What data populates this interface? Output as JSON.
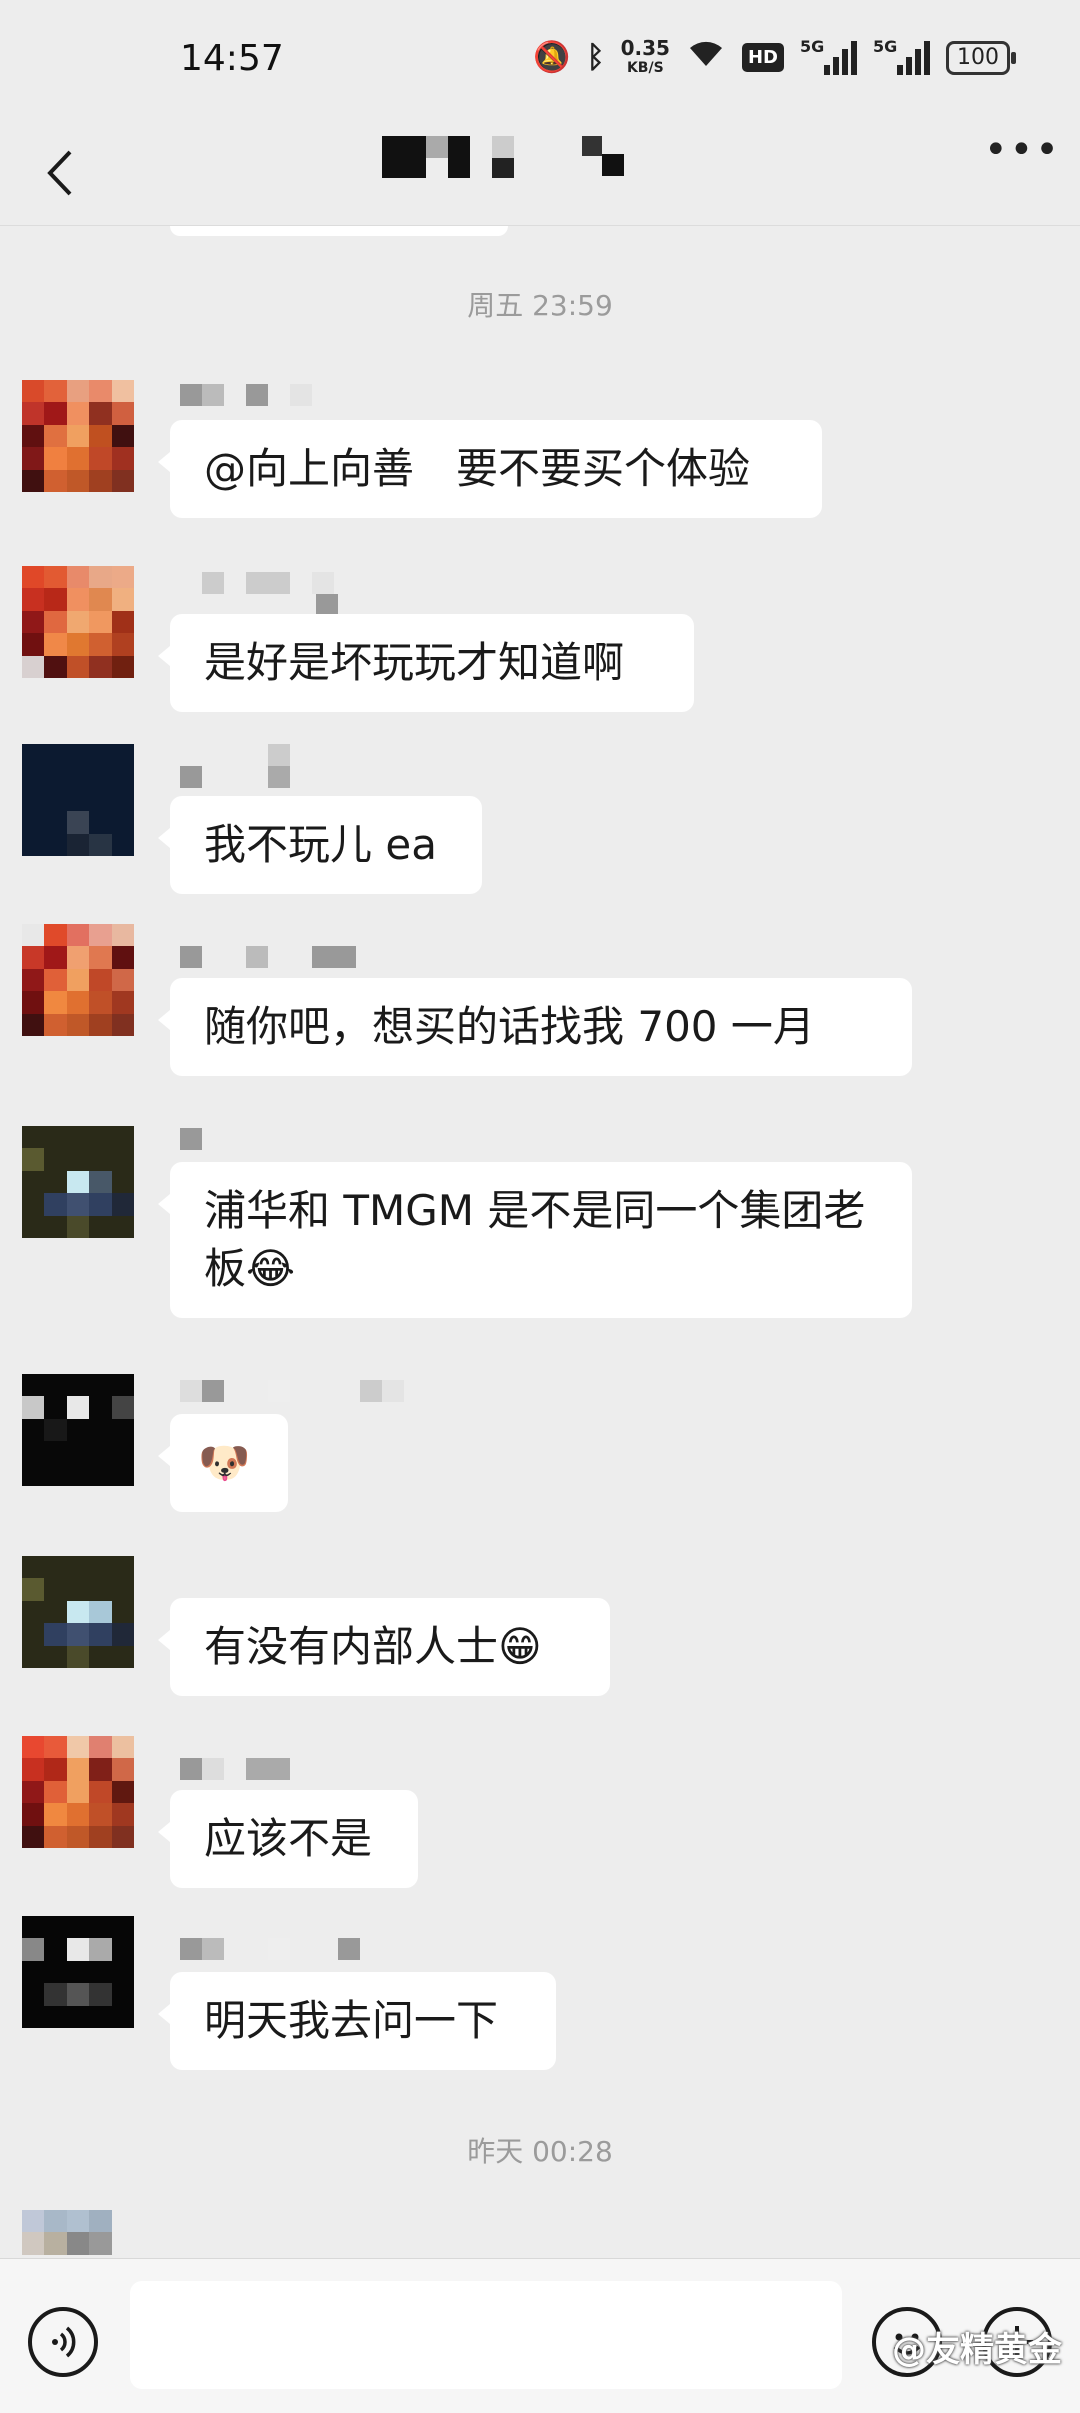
{
  "status_bar": {
    "time": "14:57",
    "net_speed_value": "0.35",
    "net_speed_unit": "KB/S",
    "hd_badge": "HD",
    "signal1_label": "5G",
    "signal2_label": "5G",
    "battery": "100"
  },
  "chat": {
    "timestamps": [
      "周五 23:59",
      "昨天 00:28"
    ],
    "messages": [
      {
        "text": "@向上向善　要不要买个体验"
      },
      {
        "text": "是好是坏玩玩才知道啊"
      },
      {
        "text": "我不玩儿 ea"
      },
      {
        "text": "随你吧，想买的话找我 700 一月"
      },
      {
        "text": "浦华和 TMGM 是不是同一个集团老板😂"
      },
      {
        "text": "🐶"
      },
      {
        "text": "有没有内部人士😁"
      },
      {
        "text": "应该不是"
      },
      {
        "text": "明天我去问一下"
      }
    ]
  },
  "watermark": "@友精黄金",
  "colors": {
    "background": "#ededed",
    "bubble": "#ffffff",
    "timestamp": "#9b9b9b"
  },
  "icons": {
    "back": "chevron-left-icon",
    "more": "more-dots-icon",
    "voice": "voice-icon",
    "emoji": "emoji-icon",
    "add": "plus-icon"
  }
}
